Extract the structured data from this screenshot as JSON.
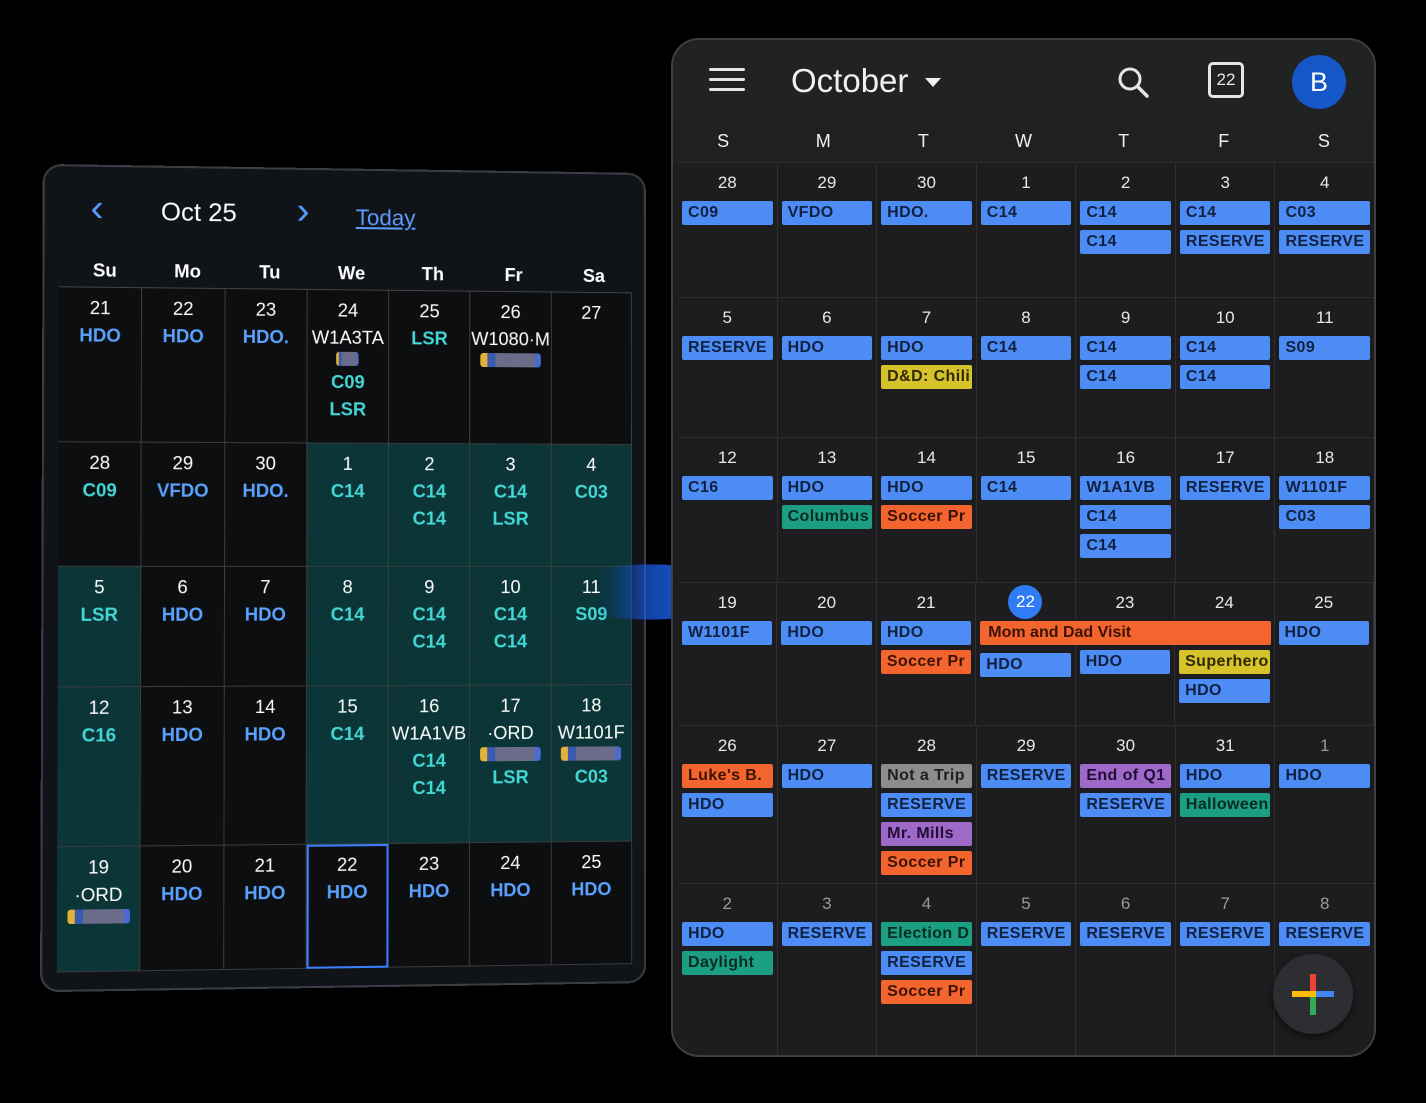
{
  "old_calendar": {
    "title": "Oct 25",
    "prev_icon": "chevron-left-icon",
    "next_icon": "chevron-right-icon",
    "today_label": "Today",
    "weekdays": [
      "Su",
      "Mo",
      "Tu",
      "We",
      "Th",
      "Fr",
      "Sa"
    ],
    "weeks": [
      [
        {
          "day": "21",
          "events": [
            {
              "t": "HDO",
              "c": "blue"
            }
          ]
        },
        {
          "day": "22",
          "events": [
            {
              "t": "HDO",
              "c": "blue"
            }
          ]
        },
        {
          "day": "23",
          "events": [
            {
              "t": "HDO.",
              "c": "blue"
            }
          ]
        },
        {
          "day": "24",
          "events": [
            {
              "t": "W1A3TA",
              "c": "white"
            },
            {
              "chip": "small"
            },
            {
              "t": "C09",
              "c": "cyan"
            },
            {
              "t": "LSR",
              "c": "cyan"
            }
          ]
        },
        {
          "day": "25",
          "events": [
            {
              "t": "LSR",
              "c": "cyan"
            }
          ]
        },
        {
          "day": "26",
          "events": [
            {
              "t": "W1080·M",
              "c": "white"
            },
            {
              "chip": "wide"
            }
          ]
        },
        {
          "day": "27",
          "events": []
        }
      ],
      [
        {
          "day": "28",
          "events": [
            {
              "t": "C09",
              "c": "cyan"
            }
          ]
        },
        {
          "day": "29",
          "events": [
            {
              "t": "VFDO",
              "c": "blue"
            }
          ]
        },
        {
          "day": "30",
          "events": [
            {
              "t": "HDO.",
              "c": "blue"
            }
          ]
        },
        {
          "day": "1",
          "teal": true,
          "events": [
            {
              "t": "C14",
              "c": "cyan"
            }
          ]
        },
        {
          "day": "2",
          "teal": true,
          "events": [
            {
              "t": "C14",
              "c": "cyan"
            },
            {
              "t": "C14",
              "c": "cyan"
            }
          ]
        },
        {
          "day": "3",
          "teal": true,
          "events": [
            {
              "t": "C14",
              "c": "cyan"
            },
            {
              "t": "LSR",
              "c": "cyan"
            }
          ]
        },
        {
          "day": "4",
          "teal": true,
          "events": [
            {
              "t": "C03",
              "c": "cyan"
            }
          ]
        }
      ],
      [
        {
          "day": "5",
          "teal": true,
          "events": [
            {
              "t": "LSR",
              "c": "cyan"
            }
          ]
        },
        {
          "day": "6",
          "events": [
            {
              "t": "HDO",
              "c": "blue"
            }
          ]
        },
        {
          "day": "7",
          "events": [
            {
              "t": "HDO",
              "c": "blue"
            }
          ]
        },
        {
          "day": "8",
          "teal": true,
          "events": [
            {
              "t": "C14",
              "c": "cyan"
            }
          ]
        },
        {
          "day": "9",
          "teal": true,
          "events": [
            {
              "t": "C14",
              "c": "cyan"
            },
            {
              "t": "C14",
              "c": "cyan"
            }
          ]
        },
        {
          "day": "10",
          "teal": true,
          "events": [
            {
              "t": "C14",
              "c": "cyan"
            },
            {
              "t": "C14",
              "c": "cyan"
            }
          ]
        },
        {
          "day": "11",
          "teal": true,
          "events": [
            {
              "t": "S09",
              "c": "cyan"
            }
          ]
        }
      ],
      [
        {
          "day": "12",
          "teal": true,
          "events": [
            {
              "t": "C16",
              "c": "cyan"
            }
          ]
        },
        {
          "day": "13",
          "events": [
            {
              "t": "HDO",
              "c": "blue"
            }
          ]
        },
        {
          "day": "14",
          "events": [
            {
              "t": "HDO",
              "c": "blue"
            }
          ]
        },
        {
          "day": "15",
          "teal": true,
          "events": [
            {
              "t": "C14",
              "c": "cyan"
            }
          ]
        },
        {
          "day": "16",
          "teal": true,
          "events": [
            {
              "t": "W1A1VB",
              "c": "white"
            },
            {
              "t": "C14",
              "c": "cyan"
            },
            {
              "t": "C14",
              "c": "cyan"
            }
          ]
        },
        {
          "day": "17",
          "teal": true,
          "events": [
            {
              "t": "·ORD",
              "c": "white"
            },
            {
              "chip": "wide"
            },
            {
              "t": "LSR",
              "c": "cyan"
            }
          ]
        },
        {
          "day": "18",
          "teal": true,
          "events": [
            {
              "t": "W1101F",
              "c": "white"
            },
            {
              "chip": "wide"
            },
            {
              "t": "C03",
              "c": "cyan"
            }
          ]
        }
      ],
      [
        {
          "day": "19",
          "teal": true,
          "events": [
            {
              "t": "·ORD",
              "c": "white"
            },
            {
              "chip": "wide"
            }
          ]
        },
        {
          "day": "20",
          "events": [
            {
              "t": "HDO",
              "c": "blue"
            }
          ]
        },
        {
          "day": "21",
          "events": [
            {
              "t": "HDO",
              "c": "blue"
            }
          ]
        },
        {
          "day": "22",
          "selected": true,
          "events": [
            {
              "t": "HDO",
              "c": "blue"
            }
          ]
        },
        {
          "day": "23",
          "events": [
            {
              "t": "HDO",
              "c": "blue"
            }
          ]
        },
        {
          "day": "24",
          "events": [
            {
              "t": "HDO",
              "c": "blue"
            }
          ]
        },
        {
          "day": "25",
          "events": [
            {
              "t": "HDO",
              "c": "blue"
            }
          ]
        }
      ]
    ]
  },
  "arrow_icon": "right-arrow-icon",
  "new_calendar": {
    "menu_icon": "hamburger-menu-icon",
    "month": "October",
    "search_icon": "search-icon",
    "today_badge": "22",
    "avatar_letter": "B",
    "weekdays": [
      "S",
      "M",
      "T",
      "W",
      "T",
      "F",
      "S"
    ],
    "weeks": [
      {
        "height": 134,
        "days": [
          {
            "n": "28",
            "ev": [
              {
                "t": "C09",
                "c": "blue"
              }
            ]
          },
          {
            "n": "29",
            "ev": [
              {
                "t": "VFDO",
                "c": "blue"
              }
            ]
          },
          {
            "n": "30",
            "ev": [
              {
                "t": "HDO.",
                "c": "blue"
              }
            ]
          },
          {
            "n": "1",
            "ev": [
              {
                "t": "C14",
                "c": "blue"
              }
            ]
          },
          {
            "n": "2",
            "ev": [
              {
                "t": "C14",
                "c": "blue"
              },
              {
                "t": "C14",
                "c": "blue"
              }
            ]
          },
          {
            "n": "3",
            "ev": [
              {
                "t": "C14",
                "c": "blue"
              },
              {
                "t": "RESERVE",
                "c": "blue"
              }
            ]
          },
          {
            "n": "4",
            "ev": [
              {
                "t": "C03",
                "c": "blue"
              },
              {
                "t": "RESERVE",
                "c": "blue"
              }
            ]
          }
        ]
      },
      {
        "height": 139,
        "days": [
          {
            "n": "5",
            "ev": [
              {
                "t": "RESERVE",
                "c": "blue"
              }
            ]
          },
          {
            "n": "6",
            "ev": [
              {
                "t": "HDO",
                "c": "blue"
              }
            ]
          },
          {
            "n": "7",
            "ev": [
              {
                "t": "HDO",
                "c": "blue"
              },
              {
                "t": "D&D: Chili",
                "c": "yellow"
              }
            ]
          },
          {
            "n": "8",
            "ev": [
              {
                "t": "C14",
                "c": "blue"
              }
            ]
          },
          {
            "n": "9",
            "ev": [
              {
                "t": "C14",
                "c": "blue"
              },
              {
                "t": "C14",
                "c": "blue"
              }
            ]
          },
          {
            "n": "10",
            "ev": [
              {
                "t": "C14",
                "c": "blue"
              },
              {
                "t": "C14",
                "c": "blue"
              }
            ]
          },
          {
            "n": "11",
            "ev": [
              {
                "t": "S09",
                "c": "blue"
              }
            ]
          }
        ]
      },
      {
        "height": 144,
        "days": [
          {
            "n": "12",
            "ev": [
              {
                "t": "C16",
                "c": "blue"
              }
            ]
          },
          {
            "n": "13",
            "ev": [
              {
                "t": "HDO",
                "c": "blue"
              },
              {
                "t": "Columbus",
                "c": "teal"
              }
            ]
          },
          {
            "n": "14",
            "ev": [
              {
                "t": "HDO",
                "c": "blue"
              },
              {
                "t": "Soccer Pr",
                "c": "orange"
              }
            ]
          },
          {
            "n": "15",
            "ev": [
              {
                "t": "C14",
                "c": "blue"
              }
            ]
          },
          {
            "n": "16",
            "ev": [
              {
                "t": "W1A1VB",
                "c": "blue"
              },
              {
                "t": "C14",
                "c": "blue"
              },
              {
                "t": "C14",
                "c": "blue"
              }
            ]
          },
          {
            "n": "17",
            "ev": [
              {
                "t": "RESERVE",
                "c": "blue"
              }
            ]
          },
          {
            "n": "18",
            "ev": [
              {
                "t": "W1101F",
                "c": "blue"
              },
              {
                "t": "C03",
                "c": "blue"
              }
            ]
          }
        ]
      },
      {
        "height": 142,
        "span": {
          "t": "Mom and Dad Visit",
          "c": "orange"
        },
        "days": [
          {
            "n": "19",
            "ev": [
              {
                "t": "W1101F",
                "c": "blue"
              }
            ]
          },
          {
            "n": "20",
            "ev": [
              {
                "t": "HDO",
                "c": "blue"
              }
            ]
          },
          {
            "n": "21",
            "ev": [
              {
                "t": "HDO",
                "c": "blue"
              },
              {
                "t": "Soccer Pr",
                "c": "orange"
              }
            ]
          },
          {
            "n": "22",
            "today": true,
            "ev": [
              {
                "t": "",
                "c": "none"
              },
              {
                "t": "HDO",
                "c": "blue"
              }
            ]
          },
          {
            "n": "23",
            "ev": [
              {
                "t": "",
                "c": "none"
              },
              {
                "t": "HDO",
                "c": "blue"
              }
            ]
          },
          {
            "n": "24",
            "ev": [
              {
                "t": "",
                "c": "none"
              },
              {
                "t": "Superhero",
                "c": "yellow"
              },
              {
                "t": "HDO",
                "c": "blue"
              }
            ]
          },
          {
            "n": "25",
            "ev": [
              {
                "t": "HDO",
                "c": "blue"
              }
            ]
          }
        ]
      },
      {
        "height": 157,
        "days": [
          {
            "n": "26",
            "ev": [
              {
                "t": "Luke's B.",
                "c": "orange"
              },
              {
                "t": "HDO",
                "c": "blue"
              }
            ]
          },
          {
            "n": "27",
            "ev": [
              {
                "t": "HDO",
                "c": "blue"
              }
            ]
          },
          {
            "n": "28",
            "ev": [
              {
                "t": "Not a Trip",
                "c": "gray"
              },
              {
                "t": "RESERVE",
                "c": "blue"
              },
              {
                "t": "Mr. Mills",
                "c": "purple"
              },
              {
                "t": "Soccer Pr",
                "c": "orange"
              }
            ]
          },
          {
            "n": "29",
            "ev": [
              {
                "t": "RESERVE",
                "c": "blue"
              }
            ]
          },
          {
            "n": "30",
            "ev": [
              {
                "t": "End of Q1",
                "c": "purple"
              },
              {
                "t": "RESERVE",
                "c": "blue"
              }
            ]
          },
          {
            "n": "31",
            "ev": [
              {
                "t": "HDO",
                "c": "blue"
              },
              {
                "t": "Halloween",
                "c": "teal"
              }
            ]
          },
          {
            "n": "1",
            "dim": true,
            "ev": [
              {
                "t": "HDO",
                "c": "blue"
              }
            ]
          }
        ]
      },
      {
        "height": 172,
        "days": [
          {
            "n": "2",
            "dim": true,
            "ev": [
              {
                "t": "HDO",
                "c": "blue"
              },
              {
                "t": "Daylight",
                "c": "teal"
              }
            ]
          },
          {
            "n": "3",
            "dim": true,
            "ev": [
              {
                "t": "RESERVE",
                "c": "blue"
              }
            ]
          },
          {
            "n": "4",
            "dim": true,
            "ev": [
              {
                "t": "Election D",
                "c": "teal"
              },
              {
                "t": "RESERVE",
                "c": "blue"
              },
              {
                "t": "Soccer Pr",
                "c": "orange"
              }
            ]
          },
          {
            "n": "5",
            "dim": true,
            "ev": [
              {
                "t": "RESERVE",
                "c": "blue"
              }
            ]
          },
          {
            "n": "6",
            "dim": true,
            "ev": [
              {
                "t": "RESERVE",
                "c": "blue"
              }
            ]
          },
          {
            "n": "7",
            "dim": true,
            "ev": [
              {
                "t": "RESERVE",
                "c": "blue"
              }
            ]
          },
          {
            "n": "8",
            "dim": true,
            "ev": [
              {
                "t": "RESERVE",
                "c": "blue"
              }
            ]
          }
        ]
      }
    ],
    "fab_icon": "plus-create-icon"
  }
}
